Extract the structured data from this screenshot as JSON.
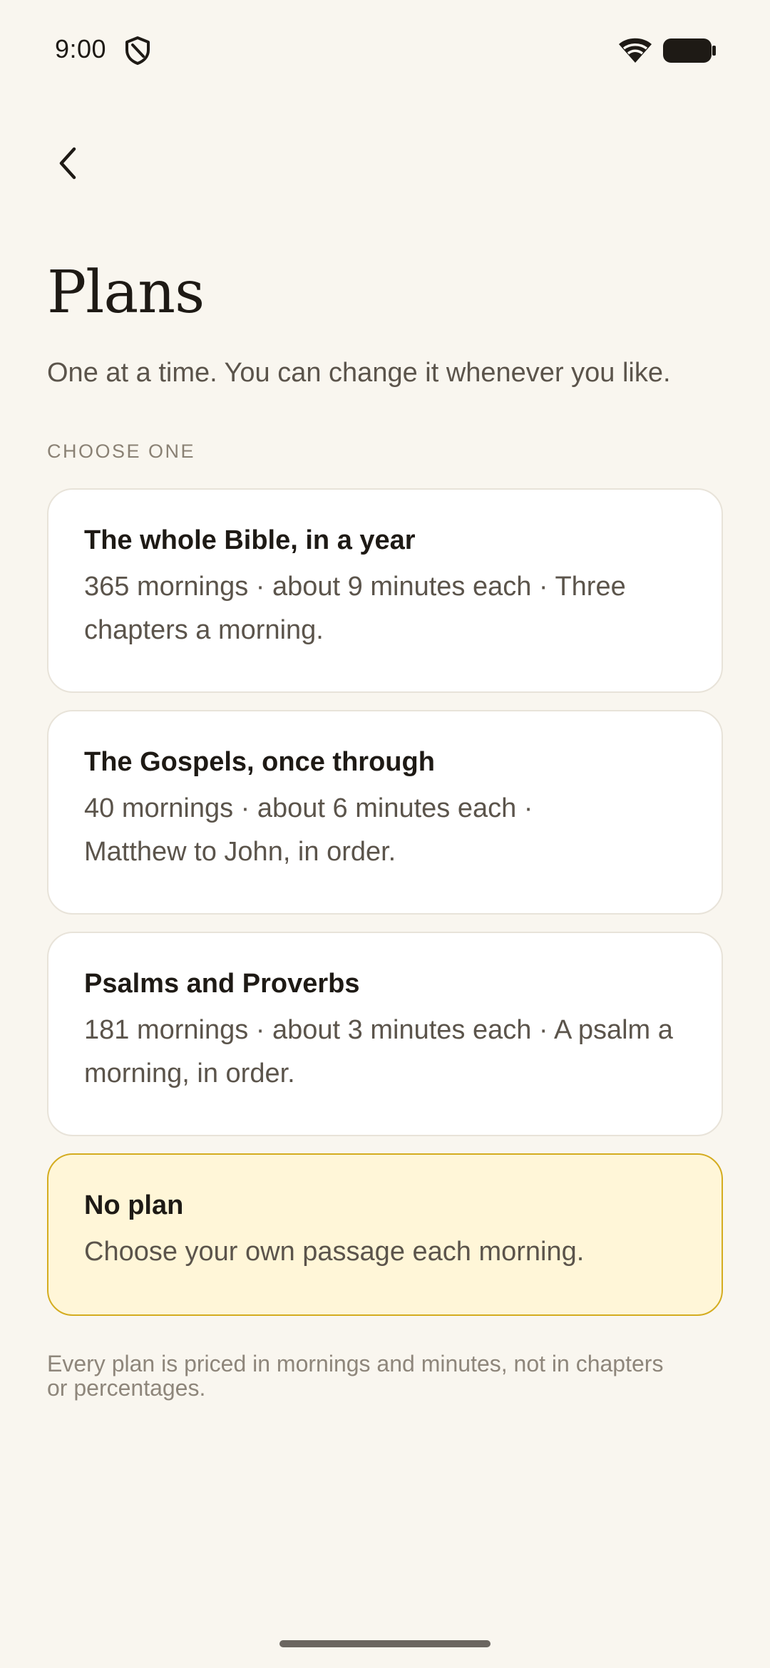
{
  "status_bar": {
    "time": "9:00",
    "icons": [
      "shield-icon",
      "wifi-icon",
      "battery-icon"
    ]
  },
  "header": {
    "back_icon": "chevron-left-icon",
    "title": "Plans",
    "subtitle": "One at a time. You can change it whenever you like."
  },
  "section": {
    "label": "CHOOSE ONE"
  },
  "plans": [
    {
      "title": "The whole Bible, in a year",
      "description": "365 mornings · about 9 minutes each · Three chapters a morning.",
      "selected": false
    },
    {
      "title": "The Gospels, once through",
      "description": "40 mornings · about 6 minutes each · Matthew to John, in order.",
      "selected": false
    },
    {
      "title": "Psalms and Proverbs",
      "description": "181 mornings · about 3 minutes each · A psalm a morning, in order.",
      "selected": false
    },
    {
      "title": "No plan",
      "description": "Choose your own passage each morning.",
      "selected": true
    }
  ],
  "footnote": "Every plan is priced in mornings and minutes, not in chapters or percentages.",
  "colors": {
    "background": "#f9f6ef",
    "card": "#ffffff",
    "card_border": "#e8e3d9",
    "selected_fill": "#fff6d8",
    "selected_border": "#d4ac1f",
    "text_primary": "#1e1a15",
    "text_secondary": "#5b544b",
    "text_muted": "#8a8174"
  }
}
